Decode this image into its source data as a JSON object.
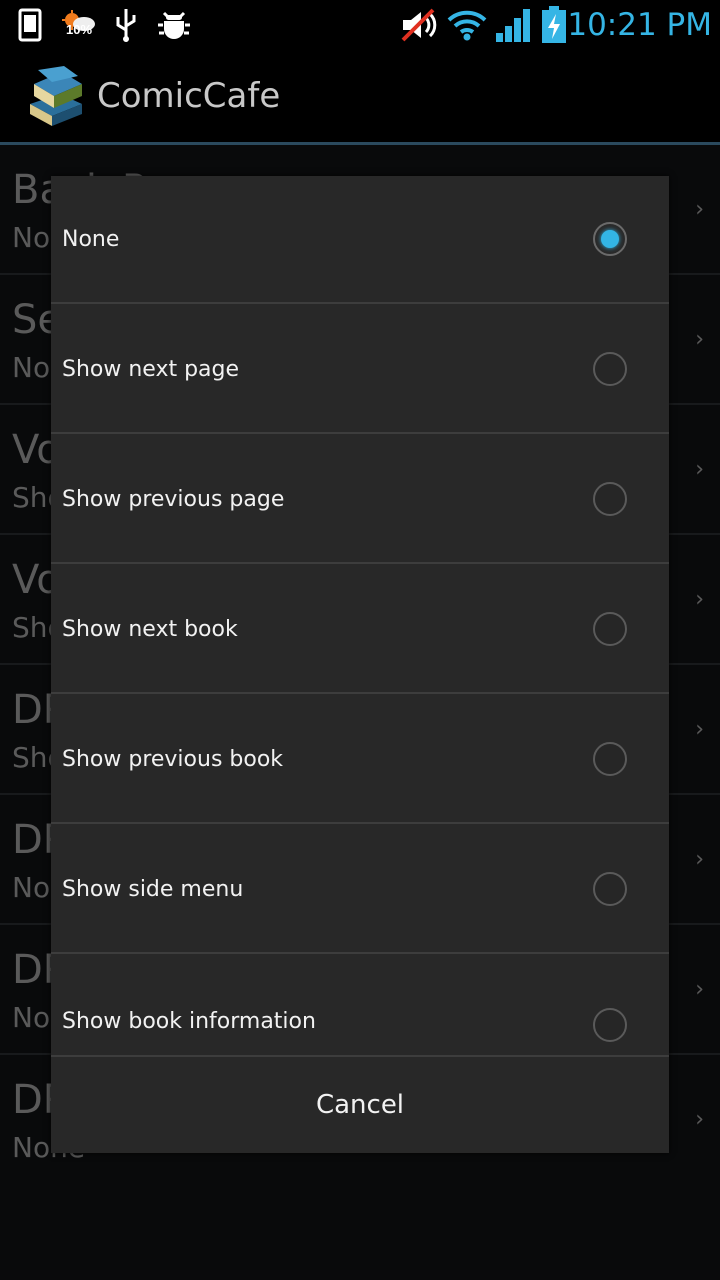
{
  "status_bar": {
    "time": "10:21 PM",
    "weather_percent": "10%",
    "accent_color": "#35b5e5"
  },
  "action_bar": {
    "title": "ComicCafe"
  },
  "background_list": [
    {
      "title": "Back P",
      "subtitle": "No",
      "chevron": "›"
    },
    {
      "title": "Se",
      "subtitle": "No",
      "chevron": "›"
    },
    {
      "title": "Vo",
      "subtitle": "Sho",
      "chevron": "›"
    },
    {
      "title": "Vo",
      "subtitle": "Sho",
      "chevron": "›"
    },
    {
      "title": "DP",
      "subtitle": "Sho",
      "chevron": "›"
    },
    {
      "title": "DP",
      "subtitle": "No",
      "chevron": "›"
    },
    {
      "title": "DP",
      "subtitle": "No",
      "chevron": "›"
    },
    {
      "title": "DP",
      "subtitle": "None",
      "chevron": "›"
    }
  ],
  "dialog": {
    "options": [
      {
        "label": "None",
        "selected": true
      },
      {
        "label": "Show next page",
        "selected": false
      },
      {
        "label": "Show previous page",
        "selected": false
      },
      {
        "label": "Show next book",
        "selected": false
      },
      {
        "label": "Show previous book",
        "selected": false
      },
      {
        "label": "Show side menu",
        "selected": false
      },
      {
        "label": "Show book information",
        "selected": false
      }
    ],
    "cancel_label": "Cancel",
    "selected_color": "#33b5e5"
  }
}
